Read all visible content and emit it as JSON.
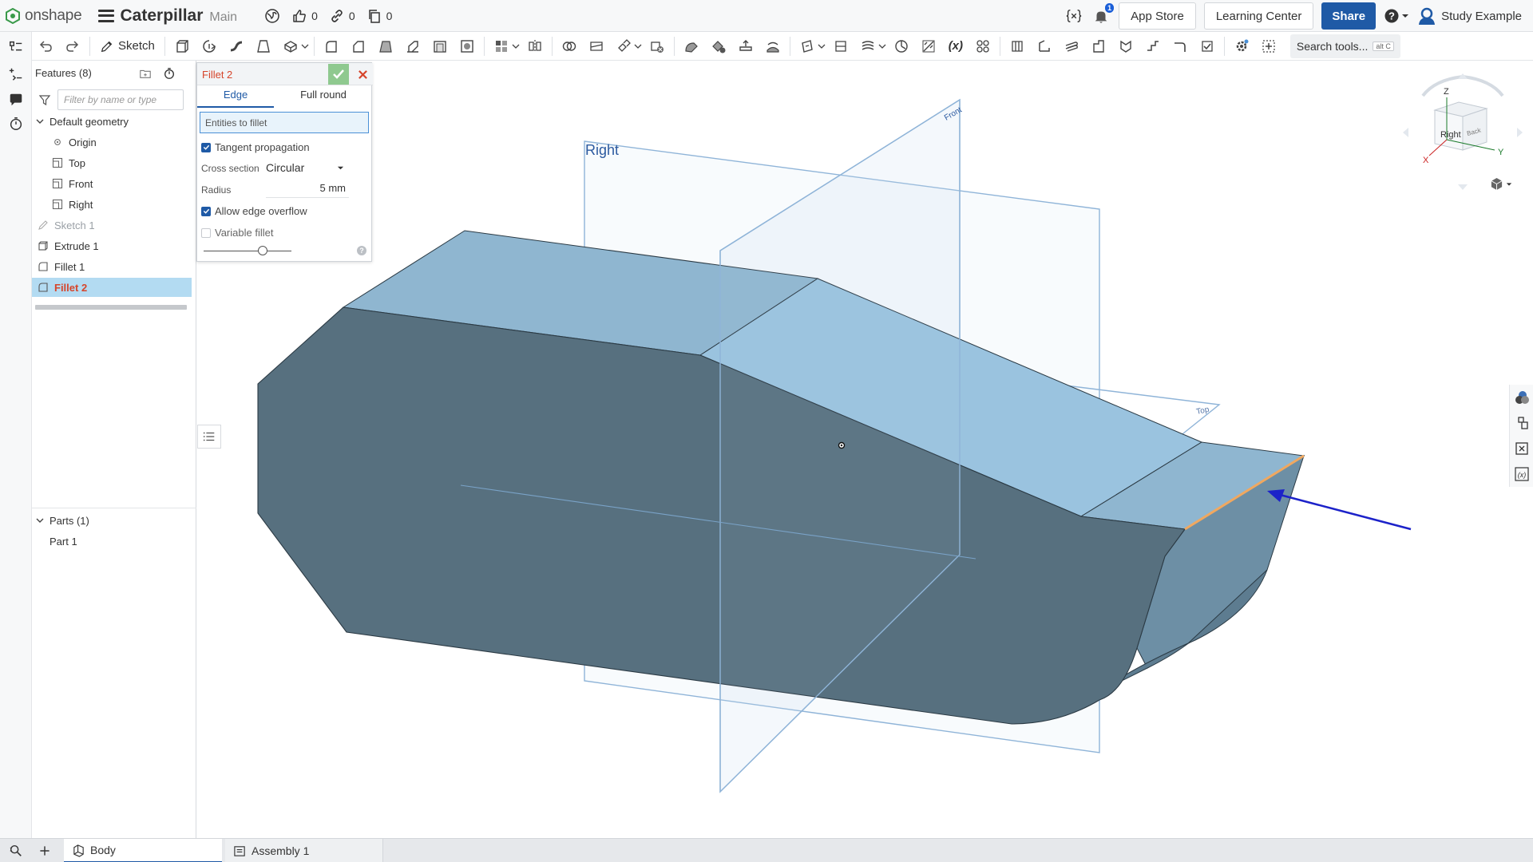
{
  "app": {
    "brand": "onshape",
    "doc_title": "Caterpillar",
    "branch": "Main",
    "likes": "0",
    "links": "0",
    "copies": "0",
    "notification_count": "1",
    "app_store": "App Store",
    "learning_center": "Learning Center",
    "share": "Share",
    "user": "Study Example"
  },
  "toolbar": {
    "sketch_label": "Sketch",
    "search_label": "Search tools...",
    "search_shortcut": "alt C",
    "variable_label": "(x)"
  },
  "features": {
    "header": "Features (8)",
    "filter_placeholder": "Filter by name or type",
    "default_geometry": "Default geometry",
    "origin": "Origin",
    "top": "Top",
    "front": "Front",
    "right": "Right",
    "sketch1": "Sketch 1",
    "extrude1": "Extrude 1",
    "fillet1": "Fillet 1",
    "fillet2": "Fillet 2",
    "parts_header": "Parts (1)",
    "part1": "Part 1"
  },
  "fillet_dialog": {
    "title": "Fillet 2",
    "tab_edge": "Edge",
    "tab_full_round": "Full round",
    "entities_label": "Entities to fillet",
    "tangent_propagation": "Tangent propagation",
    "tangent_propagation_checked": true,
    "cross_section_label": "Cross section",
    "cross_section_value": "Circular",
    "radius_label": "Radius",
    "radius_value": "5 mm",
    "allow_edge_overflow": "Allow edge overflow",
    "allow_edge_overflow_checked": true,
    "variable_fillet": "Variable fillet",
    "variable_fillet_checked": false,
    "help": "?"
  },
  "viewport": {
    "plane_right_label": "Right",
    "plane_front_label": "Front",
    "plane_top_label": "Top",
    "colors": {
      "body_front": "#57707f",
      "body_top": "#8fb6d0",
      "body_top_light": "#9ac3df",
      "body_side": "#6d8fa5",
      "highlight_edge": "#f0a860",
      "arrow": "#1c22c9"
    }
  },
  "view_cube": {
    "axis_z": "Z",
    "axis_x": "X",
    "axis_y": "Y",
    "face_right": "Right",
    "face_back": "Back"
  },
  "tabs": {
    "body": "Body",
    "assembly": "Assembly 1"
  }
}
